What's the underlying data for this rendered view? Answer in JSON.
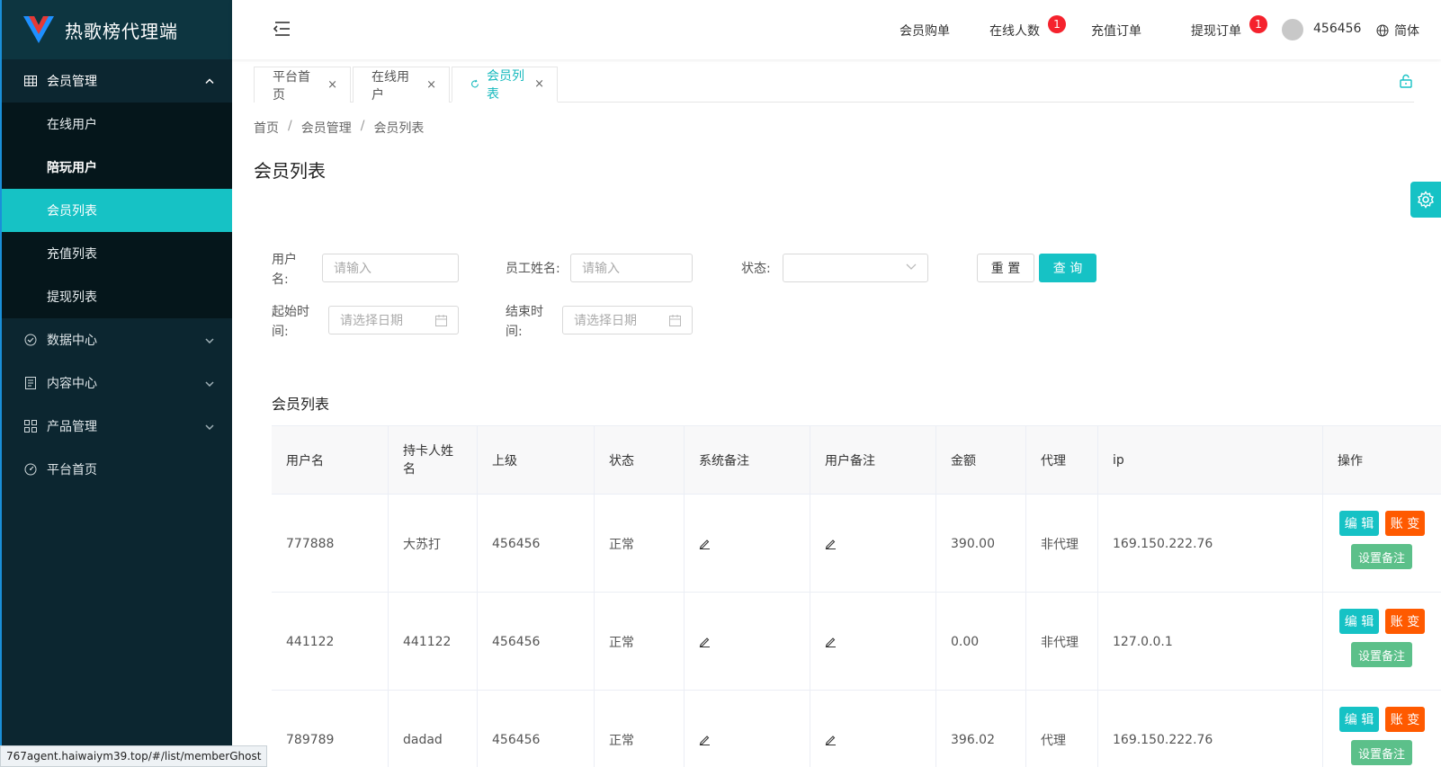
{
  "app": {
    "title": "热歌榜代理端"
  },
  "sidebar": {
    "group": {
      "label": "会员管理"
    },
    "subitems": [
      {
        "label": "在线用户"
      },
      {
        "label": "陪玩用户"
      },
      {
        "label": "会员列表"
      },
      {
        "label": "充值列表"
      },
      {
        "label": "提现列表"
      }
    ],
    "items": [
      {
        "label": "数据中心"
      },
      {
        "label": "内容中心"
      },
      {
        "label": "产品管理"
      },
      {
        "label": "平台首页"
      }
    ]
  },
  "header": {
    "links": [
      {
        "label": "会员购单"
      },
      {
        "label": "在线人数",
        "badge": "1"
      },
      {
        "label": "充值订单"
      },
      {
        "label": "提现订单",
        "badge": "1"
      }
    ],
    "username": "456456",
    "language": "简体"
  },
  "tabs": [
    {
      "label": "平台首页"
    },
    {
      "label": "在线用户"
    },
    {
      "label": "会员列表"
    }
  ],
  "breadcrumb": [
    "首页",
    "会员管理",
    "会员列表"
  ],
  "page": {
    "title": "会员列表",
    "section_title": "会员列表"
  },
  "filters": {
    "username_label": "用户名:",
    "staff_label": "员工姓名:",
    "status_label": "状态:",
    "start_label": "起始时间:",
    "end_label": "结束时间:",
    "input_placeholder": "请输入",
    "date_placeholder": "请选择日期",
    "reset_label": "重 置",
    "query_label": "查 询"
  },
  "table": {
    "columns": [
      "用户名",
      "持卡人姓名",
      "上级",
      "状态",
      "系统备注",
      "用户备注",
      "金额",
      "代理",
      "ip",
      "操作"
    ],
    "rows": [
      {
        "username": "777888",
        "holder": "大苏打",
        "parent": "456456",
        "status": "正常",
        "amount": "390.00",
        "agent": "非代理",
        "ip": "169.150.222.76"
      },
      {
        "username": "441122",
        "holder": "441122",
        "parent": "456456",
        "status": "正常",
        "amount": "0.00",
        "agent": "非代理",
        "ip": "127.0.0.1"
      },
      {
        "username": "789789",
        "holder": "dadad",
        "parent": "456456",
        "status": "正常",
        "amount": "396.02",
        "agent": "代理",
        "ip": "169.150.222.76"
      }
    ],
    "actions": {
      "edit": "编 辑",
      "account": "账 变",
      "note": "设置备注"
    }
  },
  "statusbar": {
    "url": "767agent.haiwaiym39.top/#/list/memberGhost"
  },
  "colors": {
    "accent": "#16c2c5",
    "sidebar": "#0c2630",
    "danger": "#ff5a00",
    "success": "#5cc08a",
    "badge": "#f5222d"
  }
}
